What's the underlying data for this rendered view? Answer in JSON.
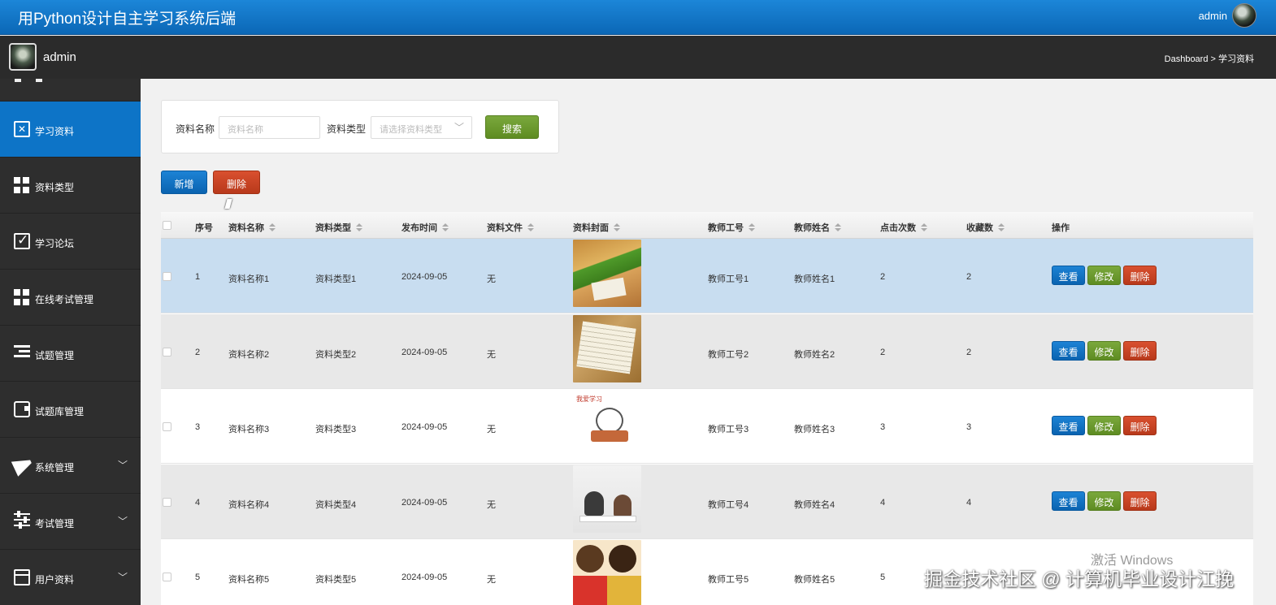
{
  "header": {
    "title": "用Python设计自主学习系统后端",
    "user": "admin"
  },
  "subbar": {
    "name": "admin",
    "breadcrumb": "Dashboard > 学习资料"
  },
  "sidebar": {
    "items": [
      {
        "label": "学习资料",
        "icon": "clipboard-icon",
        "active": true
      },
      {
        "label": "资料类型",
        "icon": "grid-icon"
      },
      {
        "label": "学习论坛",
        "icon": "checkbox-icon"
      },
      {
        "label": "在线考试管理",
        "icon": "grid-icon"
      },
      {
        "label": "试题管理",
        "icon": "outdent-icon"
      },
      {
        "label": "试题库管理",
        "icon": "wallet-icon"
      },
      {
        "label": "系统管理",
        "icon": "paper-plane-icon",
        "chevron": "﹀"
      },
      {
        "label": "考试管理",
        "icon": "sliders-icon",
        "chevron": "﹀"
      },
      {
        "label": "用户资料",
        "icon": "credit-card-icon",
        "chevron": "﹀"
      }
    ]
  },
  "search": {
    "name_label": "资料名称",
    "name_placeholder": "资料名称",
    "type_label": "资料类型",
    "type_placeholder": "请选择资料类型",
    "search_button": "搜索"
  },
  "toolbar": {
    "add_button": "新增",
    "delete_button": "删除"
  },
  "table": {
    "headers": [
      "序号",
      "资料名称",
      "资料类型",
      "发布时间",
      "资料文件",
      "资料封面",
      "教师工号",
      "教师姓名",
      "点击次数",
      "收藏数",
      "操作"
    ],
    "actions": {
      "view": "查看",
      "edit": "修改",
      "delete": "删除"
    },
    "rows": [
      {
        "no": "1",
        "name": "资料名称1",
        "type": "资料类型1",
        "date": "2024-09-05",
        "file": "无",
        "teacher_id": "教师工号1",
        "teacher_name": "教师姓名1",
        "clicks": "2",
        "favorites": "2"
      },
      {
        "no": "2",
        "name": "资料名称2",
        "type": "资料类型2",
        "date": "2024-09-05",
        "file": "无",
        "teacher_id": "教师工号2",
        "teacher_name": "教师姓名2",
        "clicks": "2",
        "favorites": "2"
      },
      {
        "no": "3",
        "name": "资料名称3",
        "type": "资料类型3",
        "date": "2024-09-05",
        "file": "无",
        "teacher_id": "教师工号3",
        "teacher_name": "教师姓名3",
        "clicks": "3",
        "favorites": "3",
        "cover_text": "我爱学习"
      },
      {
        "no": "4",
        "name": "资料名称4",
        "type": "资料类型4",
        "date": "2024-09-05",
        "file": "无",
        "teacher_id": "教师工号4",
        "teacher_name": "教师姓名4",
        "clicks": "4",
        "favorites": "4"
      },
      {
        "no": "5",
        "name": "资料名称5",
        "type": "资料类型5",
        "date": "2024-09-05",
        "file": "无",
        "teacher_id": "教师工号5",
        "teacher_name": "教师姓名5",
        "clicks": "5",
        "favorites": ""
      }
    ]
  },
  "overlay": {
    "windows_activation": "激活 Windows",
    "watermark": "掘金技术社区 @ 计算机毕业设计江挽"
  }
}
